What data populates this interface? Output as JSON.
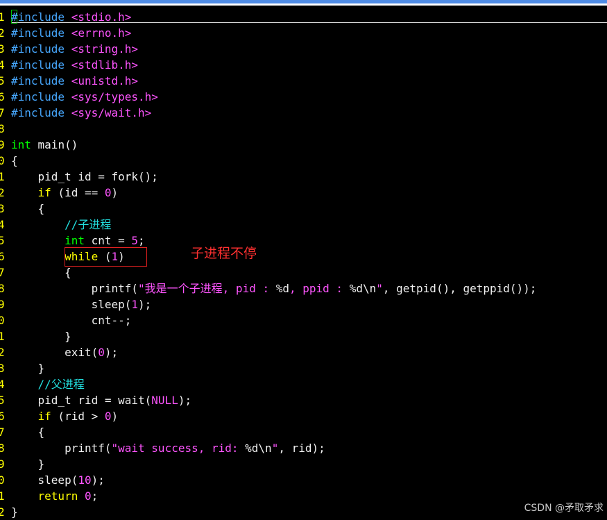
{
  "colors": {
    "default": "#f0f0f0",
    "keyword": "#ffff00",
    "type": "#00ff00",
    "preproc": "#47a8ff",
    "header": "#ff55ff",
    "number": "#ff55ff",
    "string": "#ff55ff",
    "comment": "#22e0e0",
    "line_number": "#ffff00",
    "annotation": "#ff3030"
  },
  "lines": [
    {
      "num": "1",
      "tokens": [
        {
          "t": "#include",
          "c": "preproc"
        },
        {
          "t": " "
        },
        {
          "t": "<stdio.h>",
          "c": "header"
        }
      ]
    },
    {
      "num": "2",
      "tokens": [
        {
          "t": "#include",
          "c": "preproc"
        },
        {
          "t": " "
        },
        {
          "t": "<errno.h>",
          "c": "header"
        }
      ]
    },
    {
      "num": "3",
      "tokens": [
        {
          "t": "#include",
          "c": "preproc"
        },
        {
          "t": " "
        },
        {
          "t": "<string.h>",
          "c": "header"
        }
      ]
    },
    {
      "num": "4",
      "tokens": [
        {
          "t": "#include",
          "c": "preproc"
        },
        {
          "t": " "
        },
        {
          "t": "<stdlib.h>",
          "c": "header"
        }
      ]
    },
    {
      "num": "5",
      "tokens": [
        {
          "t": "#include",
          "c": "preproc"
        },
        {
          "t": " "
        },
        {
          "t": "<unistd.h>",
          "c": "header"
        }
      ]
    },
    {
      "num": "6",
      "tokens": [
        {
          "t": "#include",
          "c": "preproc"
        },
        {
          "t": " "
        },
        {
          "t": "<sys/types.h>",
          "c": "header"
        }
      ]
    },
    {
      "num": "7",
      "tokens": [
        {
          "t": "#include",
          "c": "preproc"
        },
        {
          "t": " "
        },
        {
          "t": "<sys/wait.h>",
          "c": "header"
        }
      ]
    },
    {
      "num": "8",
      "tokens": []
    },
    {
      "num": "9",
      "tokens": [
        {
          "t": "int",
          "c": "type"
        },
        {
          "t": " main()"
        }
      ]
    },
    {
      "num": "0",
      "tokens": [
        {
          "t": "{"
        }
      ]
    },
    {
      "num": "1",
      "tokens": [
        {
          "t": "    pid_t id = fork();"
        }
      ]
    },
    {
      "num": "2",
      "tokens": [
        {
          "t": "    "
        },
        {
          "t": "if",
          "c": "keyword"
        },
        {
          "t": " (id == "
        },
        {
          "t": "0",
          "c": "number"
        },
        {
          "t": ")"
        }
      ]
    },
    {
      "num": "3",
      "tokens": [
        {
          "t": "    {"
        }
      ]
    },
    {
      "num": "4",
      "tokens": [
        {
          "t": "        "
        },
        {
          "t": "//子进程",
          "c": "comment"
        }
      ]
    },
    {
      "num": "5",
      "tokens": [
        {
          "t": "        "
        },
        {
          "t": "int",
          "c": "type"
        },
        {
          "t": " cnt = "
        },
        {
          "t": "5",
          "c": "number"
        },
        {
          "t": ";"
        }
      ]
    },
    {
      "num": "6",
      "tokens": [
        {
          "t": "        "
        },
        {
          "t": "while",
          "c": "keyword"
        },
        {
          "t": " ("
        },
        {
          "t": "1",
          "c": "number"
        },
        {
          "t": ")"
        }
      ]
    },
    {
      "num": "7",
      "tokens": [
        {
          "t": "        {"
        }
      ]
    },
    {
      "num": "8",
      "tokens": [
        {
          "t": "            printf("
        },
        {
          "t": "\"我是一个子进程, pid : ",
          "c": "string"
        },
        {
          "t": "%d",
          "c": "default"
        },
        {
          "t": ", ppid : ",
          "c": "string"
        },
        {
          "t": "%d\\n",
          "c": "default"
        },
        {
          "t": "\"",
          "c": "string"
        },
        {
          "t": ", getpid(), getppid());"
        }
      ]
    },
    {
      "num": "9",
      "tokens": [
        {
          "t": "            sleep("
        },
        {
          "t": "1",
          "c": "number"
        },
        {
          "t": ");"
        }
      ]
    },
    {
      "num": "0",
      "tokens": [
        {
          "t": "            cnt--;"
        }
      ]
    },
    {
      "num": "1",
      "tokens": [
        {
          "t": "        }"
        }
      ]
    },
    {
      "num": "2",
      "tokens": [
        {
          "t": "        exit("
        },
        {
          "t": "0",
          "c": "number"
        },
        {
          "t": ");"
        }
      ]
    },
    {
      "num": "3",
      "tokens": [
        {
          "t": "    }"
        }
      ]
    },
    {
      "num": "4",
      "tokens": [
        {
          "t": "    "
        },
        {
          "t": "//父进程",
          "c": "comment"
        }
      ]
    },
    {
      "num": "5",
      "tokens": [
        {
          "t": "    pid_t rid = wait("
        },
        {
          "t": "NULL",
          "c": "number"
        },
        {
          "t": ");"
        }
      ]
    },
    {
      "num": "6",
      "tokens": [
        {
          "t": "    "
        },
        {
          "t": "if",
          "c": "keyword"
        },
        {
          "t": " (rid > "
        },
        {
          "t": "0",
          "c": "number"
        },
        {
          "t": ")"
        }
      ]
    },
    {
      "num": "7",
      "tokens": [
        {
          "t": "    {"
        }
      ]
    },
    {
      "num": "8",
      "tokens": [
        {
          "t": "        printf("
        },
        {
          "t": "\"wait success, rid: ",
          "c": "string"
        },
        {
          "t": "%d\\n",
          "c": "default"
        },
        {
          "t": "\"",
          "c": "string"
        },
        {
          "t": ", rid);"
        }
      ]
    },
    {
      "num": "9",
      "tokens": [
        {
          "t": "    }"
        }
      ]
    },
    {
      "num": "0",
      "tokens": [
        {
          "t": "    sleep("
        },
        {
          "t": "10",
          "c": "number"
        },
        {
          "t": ");"
        }
      ]
    },
    {
      "num": "1",
      "tokens": [
        {
          "t": "    "
        },
        {
          "t": "return",
          "c": "keyword"
        },
        {
          "t": " "
        },
        {
          "t": "0",
          "c": "number"
        },
        {
          "t": ";"
        }
      ]
    },
    {
      "num": "2",
      "tokens": [
        {
          "t": "}"
        }
      ]
    }
  ],
  "annotation": {
    "text": "子进程不停"
  },
  "watermark": {
    "text": "CSDN @矛取矛求"
  }
}
